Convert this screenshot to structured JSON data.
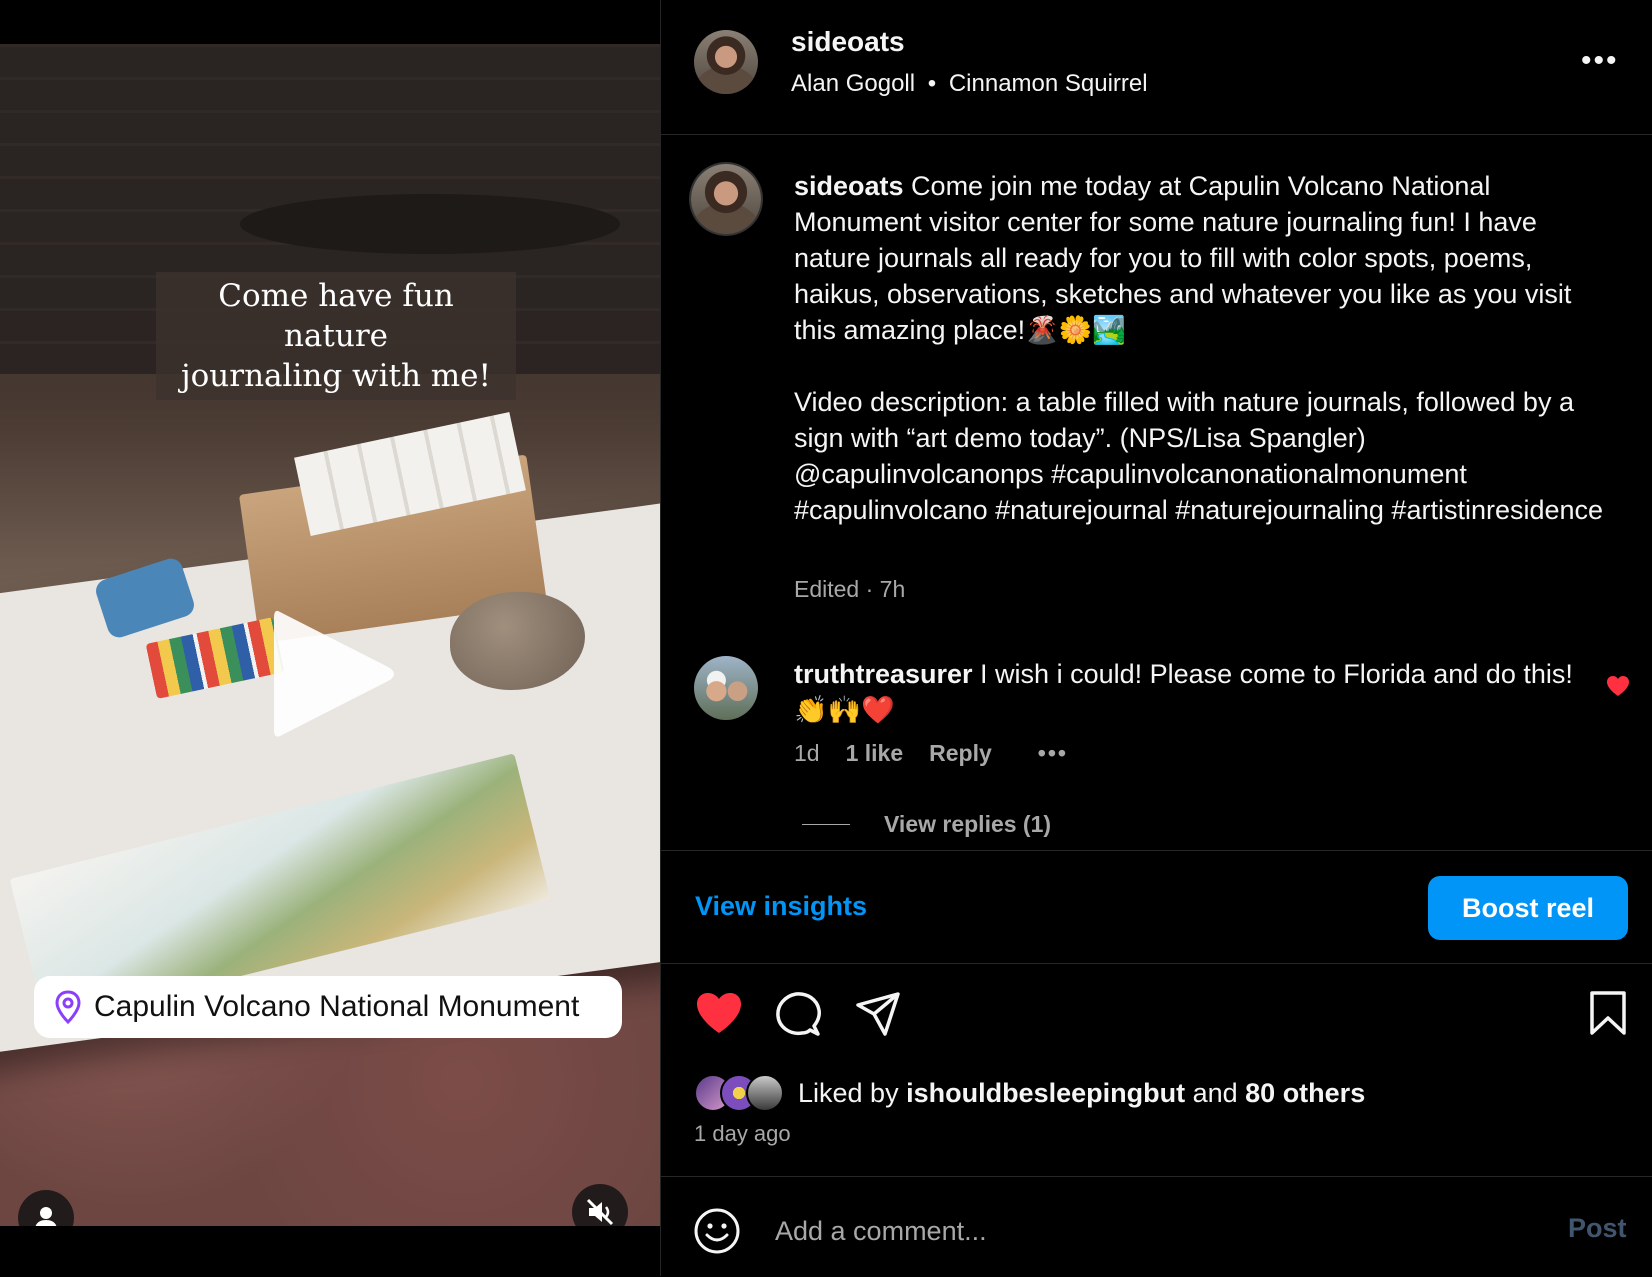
{
  "media": {
    "overlay_caption_line1": "Come have fun nature",
    "overlay_caption_line2": "journaling with me!",
    "location": "Capulin Volcano National Monument",
    "icons": [
      "play-icon",
      "location-pin-icon",
      "user-tag-icon",
      "muted-speaker-icon"
    ]
  },
  "header": {
    "username": "sideoats",
    "audio_artist": "Alan Gogoll",
    "audio_separator": "•",
    "audio_track": "Cinnamon Squirrel",
    "more": "•••"
  },
  "caption": {
    "username": "sideoats",
    "text": " Come join me today at Capulin Volcano National Monument visitor center for some nature journaling fun! I have nature journals all ready for you to fill with color spots, poems, haikus, observations, sketches and whatever you like as you visit this amazing place!🌋🌼🏞️\n\nVideo description: a table filled with nature journals, followed by a sign with “art demo today”. (NPS/Lisa Spangler) @capulinvolcanonps #capulinvolcanonationalmonument #capulinvolcano #naturejournal #naturejournaling #artistinresidence",
    "meta": "Edited · 7h"
  },
  "comment": {
    "username": "truthtreasurer",
    "text": " I wish i could! Please come to Florida and do this! 👏🙌❤️",
    "age": "1d",
    "likes": "1 like",
    "reply": "Reply",
    "more": "•••",
    "view_replies": "View replies (1)"
  },
  "insights": {
    "view_insights": "View insights",
    "boost": "Boost reel"
  },
  "likes": {
    "prefix": "Liked by ",
    "user": "ishouldbesleepingbut",
    "middle": " and ",
    "others": "80 others",
    "time_ago": "1 day ago"
  },
  "compose": {
    "placeholder": "Add a comment...",
    "post": "Post"
  },
  "colors": {
    "accent": "#0095f6",
    "like_red": "#ff3040",
    "muted_text": "#a8a8a8",
    "background": "#000000"
  }
}
